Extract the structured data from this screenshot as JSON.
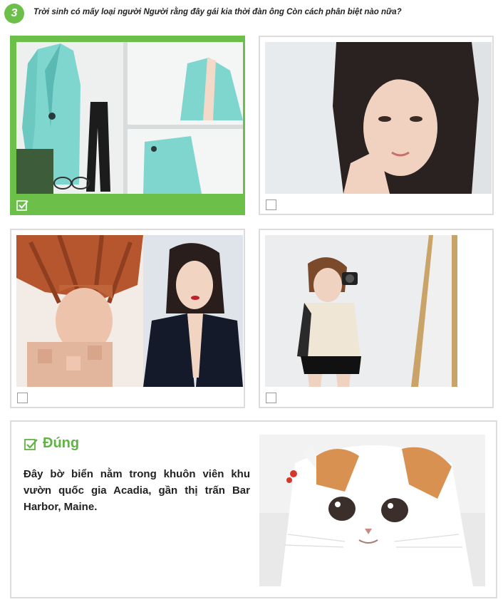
{
  "question": {
    "number": "3",
    "text": "Trời sinh có mấy loại người Người rằng đây gái kia thời đàn ông Còn cách phân biệt nào nữa?"
  },
  "options": [
    {
      "id": "opt-1",
      "selected": true,
      "checked": true,
      "image": "teal blazer fashion collage"
    },
    {
      "id": "opt-2",
      "selected": false,
      "checked": false,
      "image": "woman long dark hair portrait"
    },
    {
      "id": "opt-3",
      "selected": false,
      "checked": false,
      "image": "red-haired woman and woman in black blazer collage"
    },
    {
      "id": "opt-4",
      "selected": false,
      "checked": false,
      "image": "woman taking mirror selfie"
    }
  ],
  "answer": {
    "title": "Đúng",
    "text": "Đây bờ biển nằm trong khuôn viên khu vườn quốc gia Acadia, gần thị trấn Bar Harbor, Maine.",
    "image": "white and orange fluffy cat"
  },
  "colors": {
    "accent": "#6cc04a",
    "border": "#dcdcdc",
    "answer_title": "#5fb443"
  },
  "icons": {
    "checkbox_checked": "check-square-icon",
    "checkbox_empty": "empty-checkbox-icon"
  }
}
